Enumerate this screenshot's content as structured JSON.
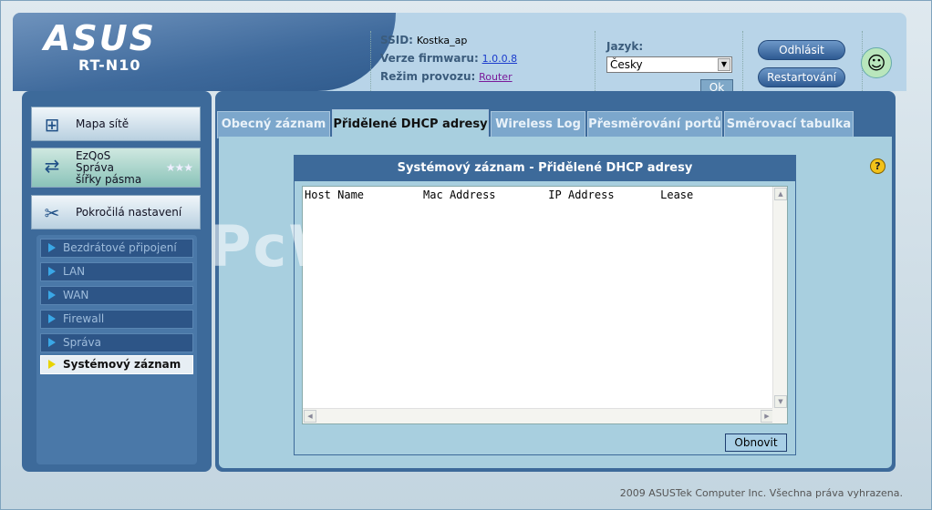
{
  "header": {
    "brand": "ASUS",
    "model": "RT-N10",
    "ssid_label": "SSID:",
    "ssid_value": "Kostka_ap",
    "firmware_label": "Verze firmwaru:",
    "firmware_value": "1.0.0.8",
    "mode_label": "Režim provozu:",
    "mode_value": "Router",
    "language_label": "Jazyk:",
    "language_selected": "Česky",
    "ok_label": "Ok",
    "logout_label": "Odhlásit",
    "restart_label": "Restartování"
  },
  "sidebar": {
    "network_map": "Mapa sítě",
    "ezqos_line1": "EzQoS",
    "ezqos_line2": "Správa",
    "ezqos_line3": "šířky pásma",
    "advanced": "Pokročilá nastavení",
    "items": [
      {
        "label": "Bezdrátové připojení"
      },
      {
        "label": "LAN"
      },
      {
        "label": "WAN"
      },
      {
        "label": "Firewall"
      },
      {
        "label": "Správa"
      },
      {
        "label": "Systémový záznam"
      }
    ]
  },
  "tabs": [
    {
      "label": "Obecný záznam"
    },
    {
      "label": "Přidělené DHCP adresy"
    },
    {
      "label": "Wireless Log"
    },
    {
      "label": "Přesměrování portů"
    },
    {
      "label": "Směrovací tabulka"
    }
  ],
  "log_panel": {
    "title": "Systémový záznam - Přidělené DHCP adresy",
    "columns_line": "Host Name         Mac Address        IP Address       Lease",
    "refresh_label": "Obnovit"
  },
  "watermark": "PcWinTech.com",
  "footer": "2009 ASUSTek Computer Inc. Všechna práva vyhrazena.",
  "colors": {
    "nav_blue": "#3d6a9a",
    "panel_bg": "#a8cfdf",
    "header_bg": "#b8d4e8"
  }
}
